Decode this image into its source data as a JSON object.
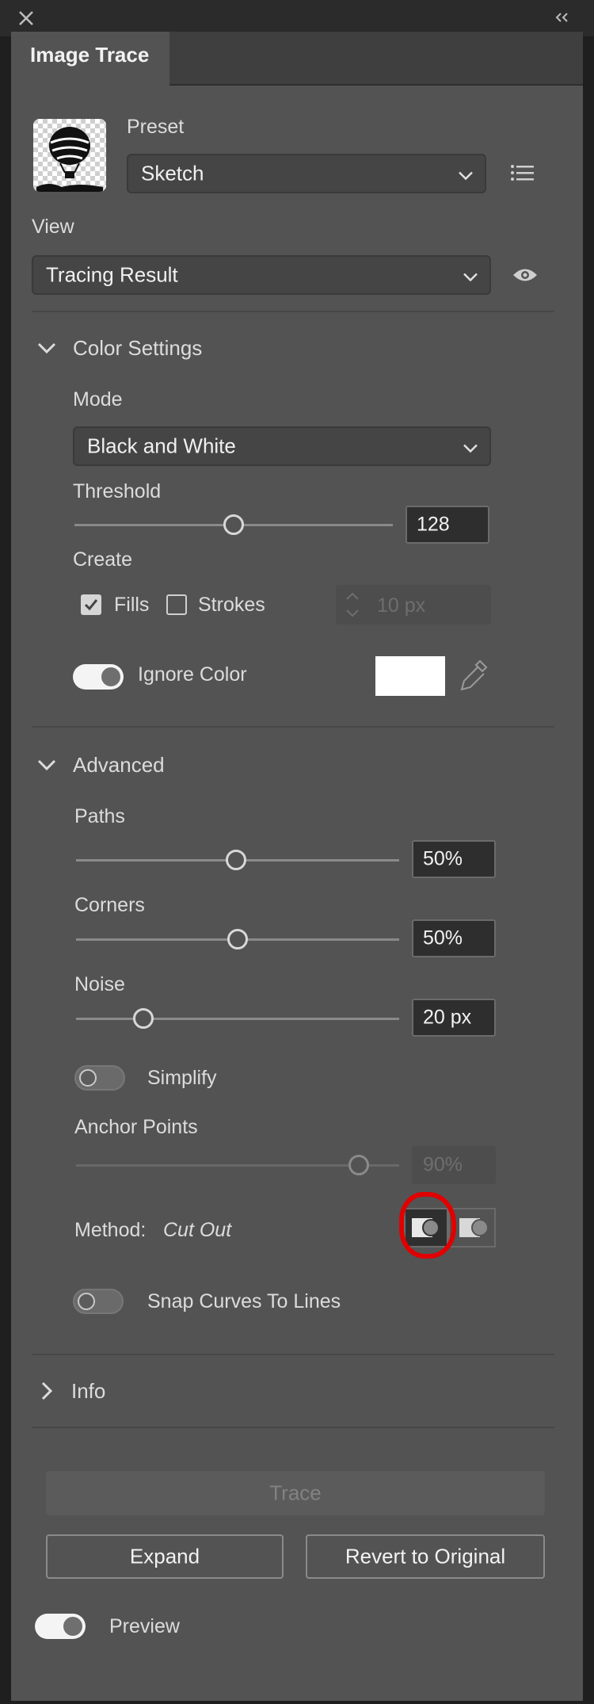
{
  "panel": {
    "title": "Image Trace"
  },
  "preset": {
    "label": "Preset",
    "value": "Sketch"
  },
  "view": {
    "label": "View",
    "value": "Tracing Result"
  },
  "color_settings": {
    "title": "Color Settings",
    "mode_label": "Mode",
    "mode_value": "Black and White",
    "threshold_label": "Threshold",
    "threshold_value": "128",
    "create_label": "Create",
    "fills_label": "Fills",
    "fills_checked": true,
    "strokes_label": "Strokes",
    "strokes_checked": false,
    "stroke_width": "10 px",
    "ignore_color_label": "Ignore Color",
    "ignore_color_on": true,
    "swatch_color": "#ffffff"
  },
  "advanced": {
    "title": "Advanced",
    "paths_label": "Paths",
    "paths_value": "50%",
    "corners_label": "Corners",
    "corners_value": "50%",
    "noise_label": "Noise",
    "noise_value": "20 px",
    "simplify_label": "Simplify",
    "simplify_on": false,
    "anchor_points_label": "Anchor Points",
    "anchor_points_value": "90%",
    "method_label": "Method:",
    "method_value": "Cut Out",
    "snap_label": "Snap Curves To Lines",
    "snap_on": false
  },
  "info": {
    "title": "Info"
  },
  "buttons": {
    "trace": "Trace",
    "expand": "Expand",
    "revert": "Revert to Original"
  },
  "preview": {
    "label": "Preview",
    "on": true
  },
  "icons": {
    "close": "close-icon",
    "collapse": "double-chevron-left-icon",
    "menu": "list-menu-icon",
    "eye": "eye-icon",
    "eyedropper": "eyedropper-icon"
  },
  "colors": {
    "highlight": "#e00000",
    "panel": "#535353"
  }
}
